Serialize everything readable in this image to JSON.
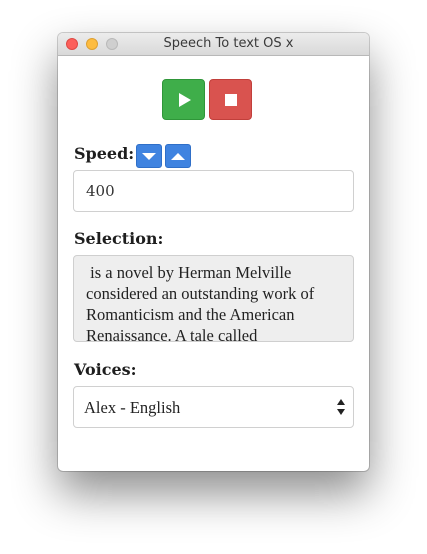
{
  "window": {
    "title": "Speech To text OS x"
  },
  "controls": {
    "play_icon": "play-icon",
    "stop_icon": "stop-icon",
    "play_color": "#3fae4a",
    "stop_color": "#d9534f"
  },
  "speed": {
    "label": "Speed:",
    "value": "400",
    "decrease_icon": "chevron-down-icon",
    "increase_icon": "chevron-up-icon",
    "button_color": "#3f83e0"
  },
  "selection": {
    "label": "Selection:",
    "text": " is a novel by Herman Melville considered an outstanding work of Romanticism and the American Renaissance. A tale called"
  },
  "voices": {
    "label": "Voices:",
    "selected": "Alex - English"
  }
}
